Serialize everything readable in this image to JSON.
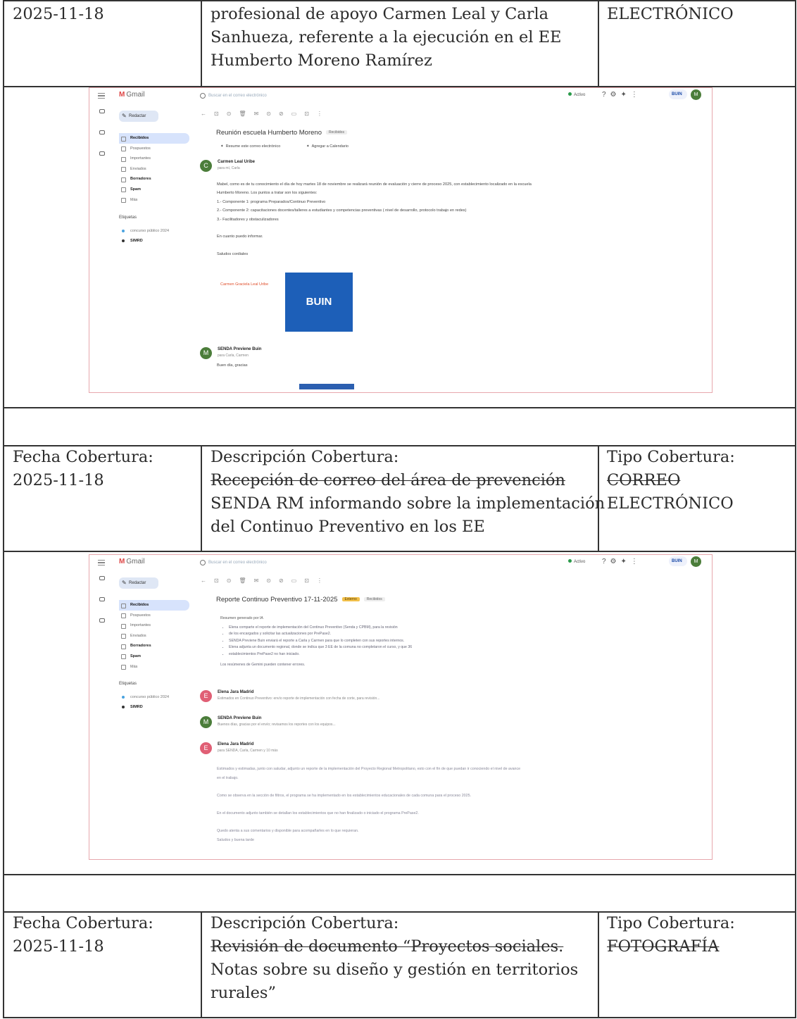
{
  "rows": [
    {
      "fecha": "2025-11-18",
      "descripcion_lines": [
        "profesional de apoyo Carmen Leal y Carla",
        "Sanhueza, referente a la ejecución en el EE",
        "Humberto Moreno Ramírez"
      ],
      "tipo": "ELECTRÓNICO"
    },
    {
      "fecha_label": "Fecha Cobertura:",
      "fecha": "2025-11-18",
      "descripcion_label": "Descripción Cobertura:",
      "descripcion_lines": [
        "Recepción de correo del área de prevención",
        "SENDA RM informando sobre la implementación",
        "del Continuo Preventivo en los EE"
      ],
      "tipo_label": "Tipo Cobertura:",
      "tipo_lines": [
        "CORREO",
        "ELECTRÓNICO"
      ]
    },
    {
      "fecha_label": "Fecha Cobertura:",
      "fecha": "2025-11-18",
      "descripcion_label": "Descripción Cobertura:",
      "descripcion_lines": [
        "Revisión de documento “Proyectos sociales.",
        "Notas sobre su diseño y gestión en territorios",
        "rurales”"
      ],
      "tipo_label": "Tipo Cobertura:",
      "tipo": "FOTOGRAFÍA"
    }
  ],
  "gmail": {
    "logo": "Gmail",
    "search_placeholder": "Buscar en el correo electrónico",
    "status": "Activo",
    "account": "BUIN",
    "avatar_letter": "M",
    "compose": "Redactar",
    "nav": [
      "Recibidos",
      "Pospuestos",
      "Importantes",
      "Enviados",
      "Borradores",
      "Spam",
      "Más"
    ],
    "labels_heading": "Etiquetas",
    "labels": [
      "concurso público 2024",
      "SIMRD"
    ],
    "icons": [
      "menu-icon",
      "search-icon",
      "help-icon",
      "gear-icon",
      "gemini-icon",
      "apps-icon"
    ]
  },
  "email1": {
    "subject": "Reunión escuela Humberto Moreno",
    "inbox_tag": "Recibidos",
    "chips": [
      "Resume este correo electrónico",
      "Agregar a Calendario"
    ],
    "sender": "Carmen Leal Uribe",
    "to": "para mí, Carla",
    "body": [
      "Mabel, como es de tu conocimiento el día de hoy martes 18 de noviembre se realizará reunión de evaluación y cierre de proceso 2025, con establecimiento localizado en la escuela",
      "Humberto Moreno. Los puntos a tratar son los siguientes:",
      "1.- Componente 1: programa Preparados/Continuo Preventivo",
      "2.- Componente 2: capacitaciones docentes/talleres a estudiantes y competencias preventivas ( nivel de desarrollo, protocolo trabajo en redes)",
      "3.- Facilitadores y obstaculizadores",
      "",
      "En cuanto puedo informar.",
      "",
      "Saludos cordiales"
    ],
    "signature_name": "Carmen Graciela Leal Uribe",
    "signature_logo": "BUIN",
    "sender2": "SENDA Previene Buin",
    "sender2_sub": "para Carla, Carmen",
    "sender2_body": "Buen día, gracias"
  },
  "email2": {
    "subject": "Reporte Continuo Preventivo 17-11-2025",
    "badge": "Externo",
    "inbox_tag": "Recibidos",
    "summary_heading": "Resumen generado por IA",
    "summary": [
      "Elena comparte el reporte de implementación del Continuo Preventivo (Senda y CPBM), para la revisión",
      "de los encargados y solicitar las actualizaciones por PrePase2.",
      "SENDA Previene Buin enviará el reporte a Carla y Carmen para que lo completen con sus reportes internos.",
      "Elena adjunta un documento regional, donde se indica que 3 EE de la comuna no completaron el curso, y que 36",
      "establecimientos PrePase2 no han iniciado."
    ],
    "summary_footer": "Los resúmenes de Gemini pueden contener errores.",
    "messages": [
      {
        "name": "Elena Jara Madrid",
        "letter": "E",
        "color": "#e05f75",
        "preview": "Estimados en Continuo Preventivo: envío reporte de implementación con fecha de corte, para revisión..."
      },
      {
        "name": "SENDA Previene Buin",
        "letter": "M",
        "color": "#4b7d3a",
        "preview": "Buenos días, gracias por el envío; revisamos los reportes con los equipos..."
      },
      {
        "name": "Elena Jara Madrid",
        "letter": "E",
        "color": "#e05f75",
        "preview": "para SENDA, Carla, Carmen y 10 más"
      }
    ],
    "body": [
      "Estimados y estimadas, junto con saludar, adjunto un reporte de la implementación del Proyecto Regional Metropolitano, esto con el fin de que puedan ir conociendo el nivel de avance",
      "en el trabajo.",
      "",
      "Como se observa en la sección de filtros, el programa se ha implementado en los establecimientos educacionales de cada comuna para el proceso 2025.",
      "",
      "En el documento adjunto también se detallan los establecimientos que no han finalizado o iniciado el programa PrePase2.",
      "",
      "Quedo atenta a sus comentarios y disponible para acompañarles en lo que requieran.",
      "Saludos y buena tarde"
    ]
  }
}
